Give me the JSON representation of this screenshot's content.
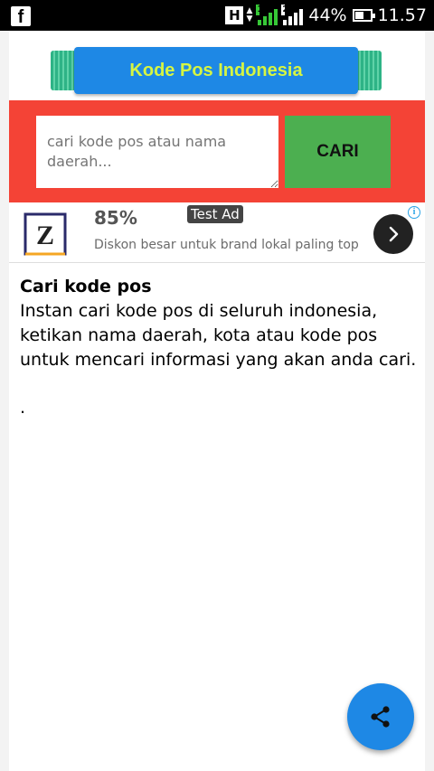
{
  "status_bar": {
    "network_type": "H",
    "sim1": "1",
    "sim2": "2",
    "battery": "44%",
    "battery_level": 0.44,
    "time": "11.57"
  },
  "header": {
    "app_title": "Kode Pos Indonesia"
  },
  "search": {
    "placeholder": "cari kode pos atau nama daerah...",
    "button_label": "CARI"
  },
  "ad": {
    "logo_letter": "Z",
    "percent": "85%",
    "label": "Test Ad",
    "description": "Diskon besar untuk brand lokal paling top",
    "info": "i"
  },
  "content": {
    "title": "Cari kode pos",
    "body": "Instan cari kode pos di seluruh indonesia, ketikan nama daerah, kota atau kode pos untuk mencari informasi yang akan anda cari.",
    "trailing": "."
  },
  "icons": {
    "fab": "share-icon",
    "ad_next": "chevron-right-icon",
    "notification": "facebook-icon"
  },
  "colors": {
    "status_bar": "#000000",
    "banner": "#1e88e5",
    "banner_text": "#d6f542",
    "search_panel": "#f44336",
    "search_button": "#4caf50",
    "fab": "#1e88e5"
  }
}
